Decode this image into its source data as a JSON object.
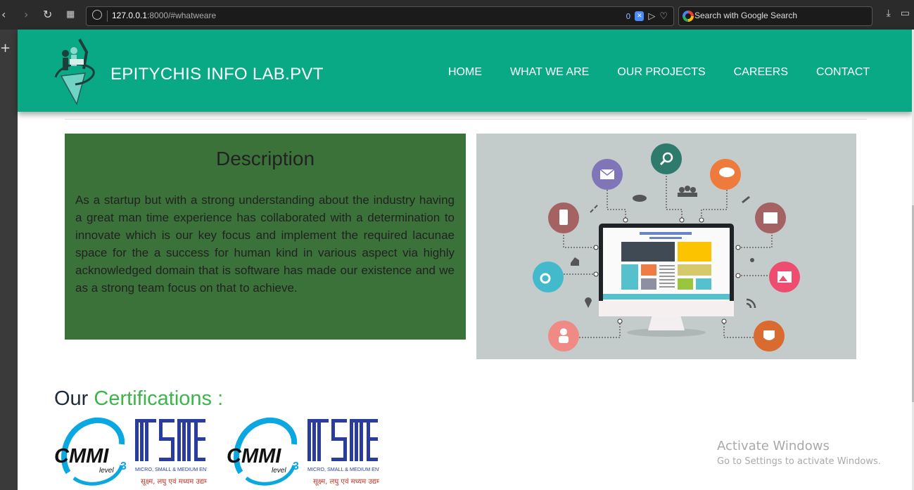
{
  "browser": {
    "url_host": "127.0.0.1",
    "url_rest": ":8000/#whatweare",
    "shield_count": "0",
    "search_placeholder": "Search with Google Search"
  },
  "site": {
    "brand": "EPITYCHIS INFO LAB.PVT",
    "nav": [
      "HOME",
      "WHAT WE ARE",
      "OUR PROJECTS",
      "CAREERS",
      "CONTACT"
    ],
    "colors": {
      "header": "#0aa986",
      "description_bg": "#3b7239",
      "cert_highlight": "#3bb54a"
    }
  },
  "description": {
    "title": "Description",
    "body": "As a startup but with a strong understanding about the industry having a great man time experience has collaborated with a determination to innovate which is our key focus and implement the required lacunae space for the a success for human kind in various aspect via highly acknowledged domain that is software has made our existence and we as a strong team focus on that to achieve."
  },
  "certifications": {
    "title_prefix": "Our",
    "title_highlight": "Certifications :",
    "cmmi_text": "CMMI",
    "cmmi_level": "level",
    "cmmi_level_num": "3",
    "msme_caption": "MICRO, SMALL & MEDIUM ENTERPRISES",
    "msme_hindi": "सूक्ष्म, लघु एवं मध्यम उद्यम"
  },
  "watermark": {
    "title": "Activate Windows",
    "subtitle": "Go to Settings to activate Windows."
  }
}
